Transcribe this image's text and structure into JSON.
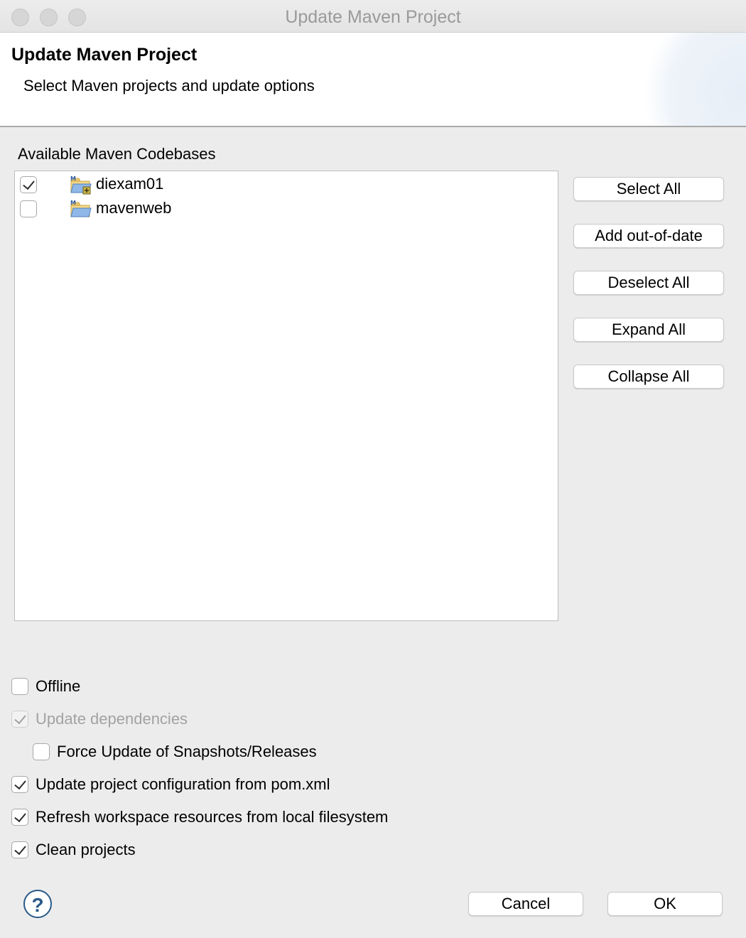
{
  "window": {
    "title": "Update Maven Project"
  },
  "header": {
    "title": "Update Maven Project",
    "description": "Select Maven projects and update options"
  },
  "codebases": {
    "label": "Available Maven Codebases",
    "items": [
      {
        "name": "diexam01",
        "checked": true,
        "icon": "maven-project-folder-icon"
      },
      {
        "name": "mavenweb",
        "checked": false,
        "icon": "maven-project-folder-icon"
      }
    ]
  },
  "side_buttons": {
    "select_all": "Select All",
    "add_out_of_date": "Add out-of-date",
    "deselect_all": "Deselect All",
    "expand_all": "Expand All",
    "collapse_all": "Collapse All"
  },
  "options": {
    "offline": {
      "label": "Offline",
      "checked": false
    },
    "update_dependencies": {
      "label": "Update dependencies",
      "checked": true,
      "disabled": true
    },
    "force_update": {
      "label": "Force Update of Snapshots/Releases",
      "checked": false
    },
    "update_config": {
      "label": "Update project configuration from pom.xml",
      "checked": true
    },
    "refresh_workspace": {
      "label": "Refresh workspace resources from local filesystem",
      "checked": true
    },
    "clean_projects": {
      "label": "Clean projects",
      "checked": true
    }
  },
  "footer": {
    "help_glyph": "?",
    "cancel": "Cancel",
    "ok": "OK"
  }
}
